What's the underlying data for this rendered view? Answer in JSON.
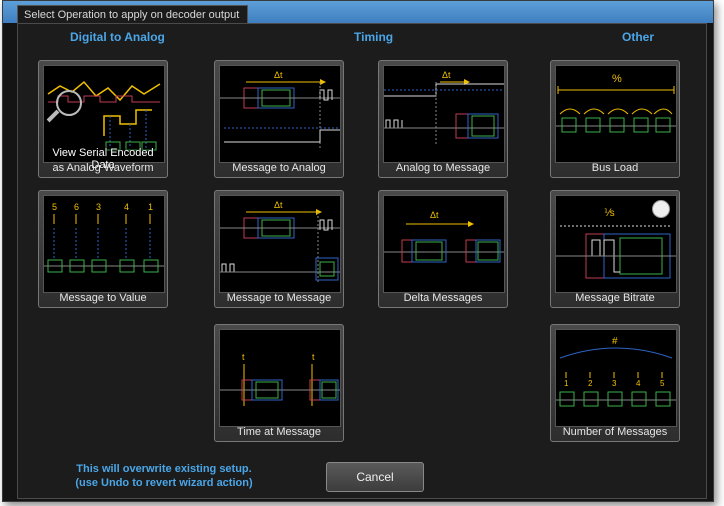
{
  "dialog": {
    "title": "Select Operation to apply on decoder output",
    "headers": {
      "digital": "Digital to Analog",
      "timing": "Timing",
      "other": "Other"
    },
    "cards": {
      "serial_overlay_1": "View Serial Encoded Data",
      "serial_label": "as Analog Waveform",
      "msg_to_value": "Message to Value",
      "msg_to_analog": "Message to Analog",
      "msg_to_msg": "Message to Message",
      "time_at_msg": "Time at Message",
      "analog_to_msg": "Analog to Message",
      "delta_msgs": "Delta Messages",
      "bus_load": "Bus Load",
      "msg_bitrate": "Message Bitrate",
      "num_msgs": "Number of Messages"
    },
    "art_text": {
      "delta_t": "Δt",
      "t": "t",
      "percent": "%",
      "fraction": "⅟s",
      "hash": "#",
      "values": [
        "5",
        "6",
        "3",
        "4",
        "1"
      ],
      "counts": [
        "1",
        "2",
        "3",
        "4",
        "5"
      ]
    },
    "note_line1": "This will overwrite existing setup.",
    "note_line2": "(use Undo to revert wizard action)",
    "cancel": "Cancel"
  },
  "colors": {
    "accent": "#4aa6e8",
    "highlight": "#f0c000",
    "signal_green": "#3bb04a",
    "signal_red": "#c03a55",
    "box_blue": "#2f64c8"
  }
}
